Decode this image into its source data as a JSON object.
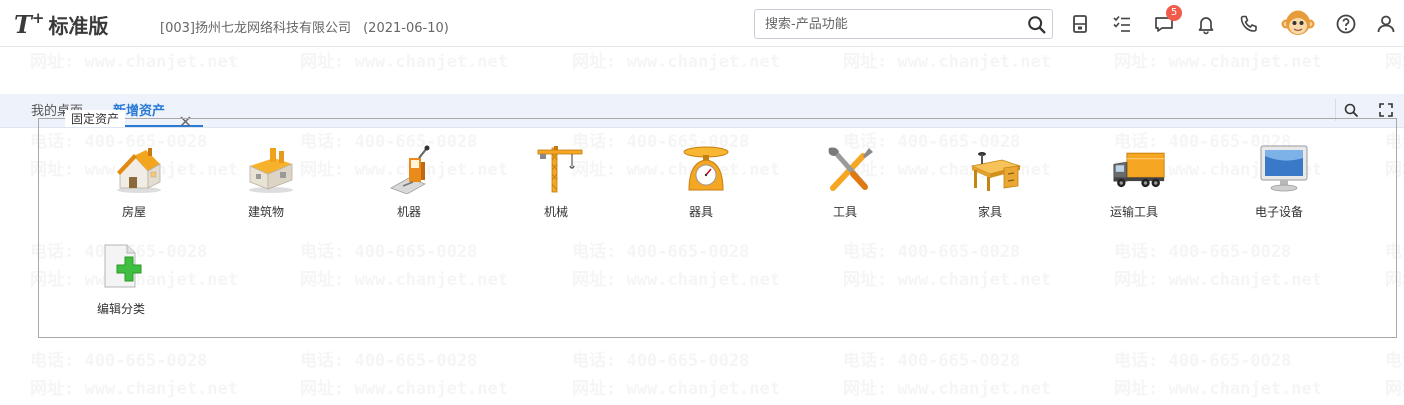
{
  "header": {
    "logo_mark": "T",
    "logo_plus": "+",
    "logo_text": "标准版",
    "company": "[003]扬州七龙网络科技有限公司",
    "date": "(2021-06-10)",
    "search_placeholder": "搜索-产品功能",
    "notification_count": "5",
    "toolbar_icons": [
      "calculator-icon",
      "checklist-icon",
      "message-icon",
      "bell-icon",
      "phone-icon",
      "avatar",
      "help-icon",
      "user-icon"
    ]
  },
  "tabs": {
    "home_label": "我的桌面",
    "active_label": "新增资产"
  },
  "watermark": {
    "phone": "电话: 400-665-0028",
    "site": "网址: www.chanjet.net"
  },
  "fixed_assets": {
    "legend": "固定资产",
    "items": [
      {
        "label": "房屋",
        "icon": "house-icon"
      },
      {
        "label": "建筑物",
        "icon": "building-icon"
      },
      {
        "label": "机器",
        "icon": "machine-icon"
      },
      {
        "label": "机械",
        "icon": "crane-icon"
      },
      {
        "label": "器具",
        "icon": "scale-icon"
      },
      {
        "label": "工具",
        "icon": "tools-icon"
      },
      {
        "label": "家具",
        "icon": "desk-icon"
      },
      {
        "label": "运输工具",
        "icon": "truck-icon"
      },
      {
        "label": "电子设备",
        "icon": "monitor-icon"
      },
      {
        "label": "编辑分类",
        "icon": "add-document-icon"
      }
    ]
  },
  "colors": {
    "accent": "#2b7bd6",
    "badge": "#f25a4a",
    "icon_orange": "#f5a623",
    "add_green": "#3fbf3f"
  }
}
